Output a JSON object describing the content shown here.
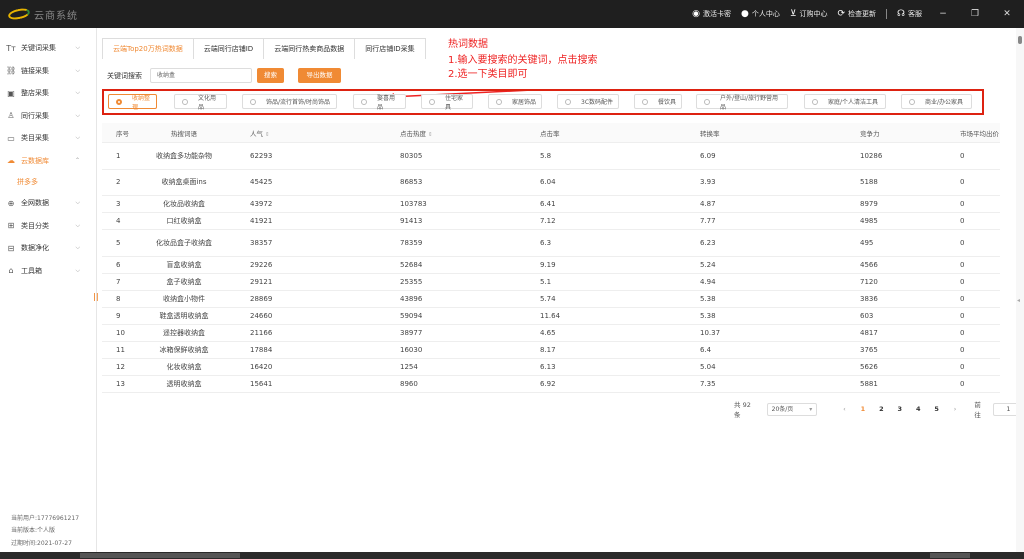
{
  "app": {
    "title": "云商系统"
  },
  "titlebar": {
    "items": [
      {
        "icon": "key-icon",
        "label": "激活卡密"
      },
      {
        "icon": "user-icon",
        "label": "个人中心"
      },
      {
        "icon": "cart-icon",
        "label": "订购中心"
      },
      {
        "icon": "refresh-icon",
        "label": "检查更新"
      },
      {
        "icon": "headset-icon",
        "label": "客服"
      }
    ]
  },
  "sidebar": {
    "items": [
      {
        "icon": "text-icon",
        "label": "关键词采集"
      },
      {
        "icon": "link-icon",
        "label": "链接采集"
      },
      {
        "icon": "store-icon",
        "label": "整店采集"
      },
      {
        "icon": "people-icon",
        "label": "同行采集"
      },
      {
        "icon": "folder-icon",
        "label": "类目采集"
      },
      {
        "icon": "cloud-icon",
        "label": "云数据库"
      },
      {
        "icon": "globe-icon",
        "label": "全网数据"
      },
      {
        "icon": "grid-icon",
        "label": "类目分类"
      },
      {
        "icon": "database-icon",
        "label": "数据净化"
      },
      {
        "icon": "toolbox-icon",
        "label": "工具箱"
      }
    ],
    "sub_item": "拼多多",
    "footer": {
      "user": "当前用户:17776961217",
      "version": "当前版本:个人版",
      "expire": "过期时间:2021-07-27"
    }
  },
  "tabs": [
    "云端Top20万热词数据",
    "云端同行店铺ID",
    "云端同行热卖商品数据",
    "同行店铺ID采集"
  ],
  "annotation": {
    "title": "热词数据",
    "step1": "1.输入要搜索的关键词，点击搜索",
    "step2": "2.选一下类目即可",
    "color": "#e22222"
  },
  "search": {
    "label": "关键词搜索",
    "value": "收纳盒",
    "search_button": "搜索",
    "export_button": "导出数据"
  },
  "categories": [
    "收纳整理",
    "文化用品",
    "饰品/流行首饰/时尚饰品",
    "娶喜用品",
    "住宅家具",
    "家居饰品",
    "3C数码配件",
    "餐饮具",
    "户外/登山/旅行野营用品",
    "家庭/个人清洁工具",
    "商业/办公家具"
  ],
  "table": {
    "headers": [
      "序号",
      "热搜词语",
      "人气",
      "点击热度",
      "点击率",
      "转换率",
      "竞争力",
      "市场平均出价"
    ],
    "rows": [
      [
        "1",
        "收纳盒多功能杂物",
        "62293",
        "80305",
        "5.8",
        "6.09",
        "10286",
        "0"
      ],
      [
        "2",
        "收纳盒桌面ins",
        "45425",
        "86853",
        "6.04",
        "3.93",
        "5188",
        "0"
      ],
      [
        "3",
        "化妆品收纳盒",
        "43972",
        "103783",
        "6.41",
        "4.87",
        "8979",
        "0"
      ],
      [
        "4",
        "口红收纳盒",
        "41921",
        "91413",
        "7.12",
        "7.77",
        "4985",
        "0"
      ],
      [
        "5",
        "化妆品盒子收纳盒",
        "38357",
        "78359",
        "6.3",
        "6.23",
        "495",
        "0"
      ],
      [
        "6",
        "盲盒收纳盒",
        "29226",
        "52684",
        "9.19",
        "5.24",
        "4566",
        "0"
      ],
      [
        "7",
        "盒子收纳盒",
        "29121",
        "25355",
        "5.1",
        "4.94",
        "7120",
        "0"
      ],
      [
        "8",
        "收纳盒小物件",
        "28869",
        "43896",
        "5.74",
        "5.38",
        "3836",
        "0"
      ],
      [
        "9",
        "鞋盒透明收纳盒",
        "24660",
        "59094",
        "11.64",
        "5.38",
        "603",
        "0"
      ],
      [
        "10",
        "遥控器收纳盒",
        "21166",
        "38977",
        "4.65",
        "10.37",
        "4817",
        "0"
      ],
      [
        "11",
        "冰箱保鲜收纳盒",
        "17884",
        "16030",
        "8.17",
        "6.4",
        "3765",
        "0"
      ],
      [
        "12",
        "化妆收纳盒",
        "16420",
        "1254",
        "6.13",
        "5.04",
        "5626",
        "0"
      ],
      [
        "13",
        "透明收纳盒",
        "15641",
        "8960",
        "6.92",
        "7.35",
        "5881",
        "0"
      ]
    ]
  },
  "pagination": {
    "total": "共 92 条",
    "page_size": "20条/页",
    "pages": [
      "1",
      "2",
      "3",
      "4",
      "5"
    ],
    "goto_label": "前往",
    "goto_value": "1"
  },
  "colors": {
    "accent": "#f08a34",
    "highlight_box": "#d22222",
    "titlebar": "#1f1f1f"
  }
}
